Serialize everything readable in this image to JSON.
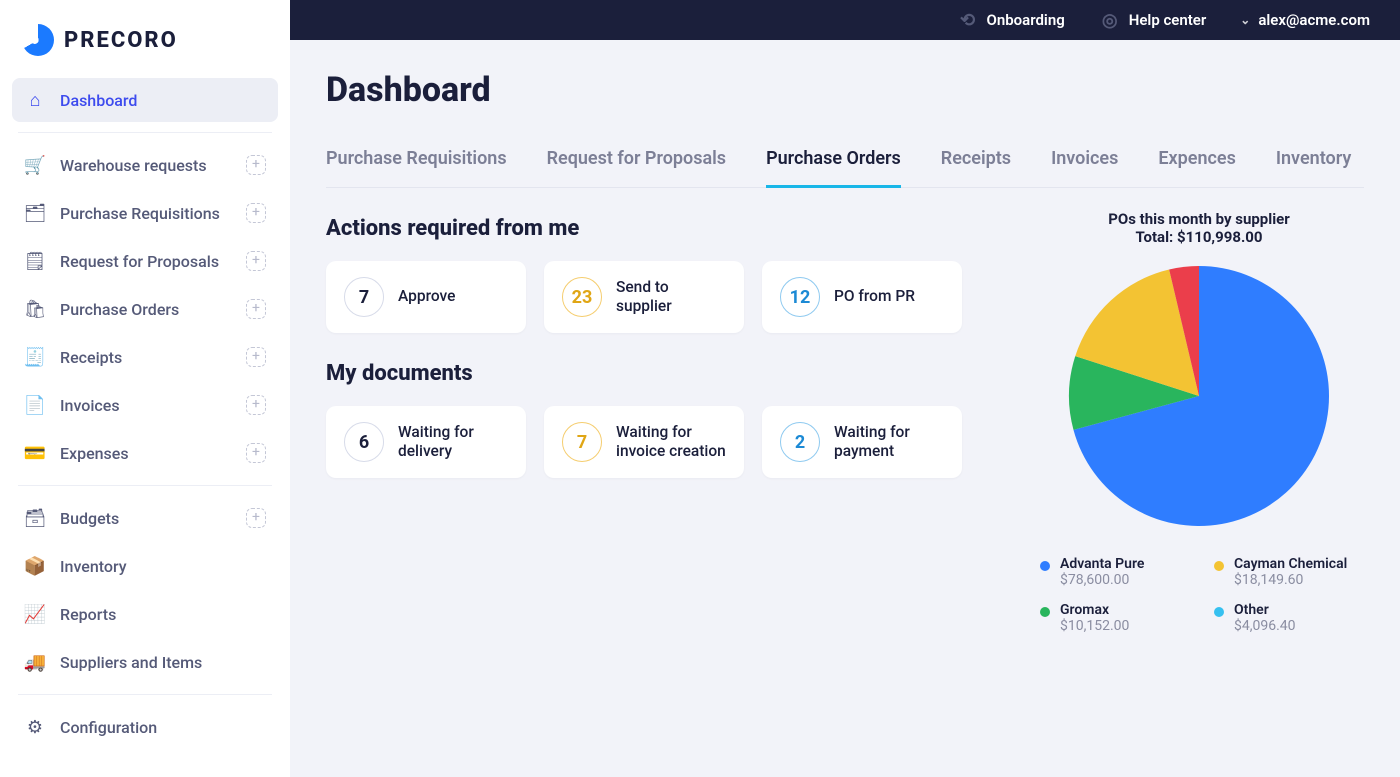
{
  "brand": {
    "name": "PRECORO"
  },
  "topbar": {
    "onboarding": "Onboarding",
    "help": "Help center",
    "user": "alex@acme.com"
  },
  "sidebar": {
    "groups": [
      {
        "items": [
          {
            "label": "Dashboard",
            "icon": "home",
            "active": true,
            "plus": false
          }
        ]
      },
      {
        "items": [
          {
            "label": "Warehouse requests",
            "icon": "warehouse",
            "active": false,
            "plus": true
          },
          {
            "label": "Purchase Requisitions",
            "icon": "requisition",
            "active": false,
            "plus": true
          },
          {
            "label": "Request for Proposals",
            "icon": "rfp",
            "active": false,
            "plus": true
          },
          {
            "label": "Purchase Orders",
            "icon": "orders",
            "active": false,
            "plus": true
          },
          {
            "label": "Receipts",
            "icon": "receipts",
            "active": false,
            "plus": true
          },
          {
            "label": "Invoices",
            "icon": "invoices",
            "active": false,
            "plus": true
          },
          {
            "label": "Expenses",
            "icon": "expenses",
            "active": false,
            "plus": true
          }
        ]
      },
      {
        "items": [
          {
            "label": "Budgets",
            "icon": "budgets",
            "active": false,
            "plus": true
          },
          {
            "label": "Inventory",
            "icon": "inventory",
            "active": false,
            "plus": false
          },
          {
            "label": "Reports",
            "icon": "reports",
            "active": false,
            "plus": false
          },
          {
            "label": "Suppliers and Items",
            "icon": "suppliers",
            "active": false,
            "plus": false
          }
        ]
      },
      {
        "items": [
          {
            "label": "Configuration",
            "icon": "config",
            "active": false,
            "plus": false
          }
        ]
      }
    ]
  },
  "page": {
    "title": "Dashboard",
    "tabs": [
      {
        "label": "Purchase Requisitions",
        "active": false
      },
      {
        "label": "Request for Proposals",
        "active": false
      },
      {
        "label": "Purchase Orders",
        "active": true
      },
      {
        "label": "Receipts",
        "active": false
      },
      {
        "label": "Invoices",
        "active": false
      },
      {
        "label": "Expences",
        "active": false
      },
      {
        "label": "Inventory",
        "active": false
      }
    ],
    "actions_title": "Actions required from me",
    "actions": [
      {
        "count": "7",
        "label": "Approve",
        "color": "plain"
      },
      {
        "count": "23",
        "label": "Send to supplier",
        "color": "yellow"
      },
      {
        "count": "12",
        "label": "PO from PR",
        "color": "blue"
      }
    ],
    "mydocs_title": "My documents",
    "mydocs": [
      {
        "count": "6",
        "label": "Waiting for delivery",
        "color": "plain"
      },
      {
        "count": "7",
        "label": "Waiting for invoice creation",
        "color": "yellow"
      },
      {
        "count": "2",
        "label": "Waiting for payment",
        "color": "blue"
      }
    ]
  },
  "chart_data": {
    "type": "pie",
    "title": "POs this month by supplier",
    "subtitle": "Total: $110,998.00",
    "series": [
      {
        "name": "Advanta Pure",
        "value": 78600.0,
        "display": "$78,600.00",
        "color": "#2f7dff"
      },
      {
        "name": "Cayman Chemical",
        "value": 18149.6,
        "display": "$18,149.60",
        "color": "#f3c333"
      },
      {
        "name": "Gromax",
        "value": 10152.0,
        "display": "$10,152.00",
        "color": "#29b55d"
      },
      {
        "name": "Other",
        "value": 4096.4,
        "display": "$4,096.40",
        "color": "#36c0f0"
      }
    ],
    "colors": {
      "red_slice": "#eb3e4b"
    }
  }
}
